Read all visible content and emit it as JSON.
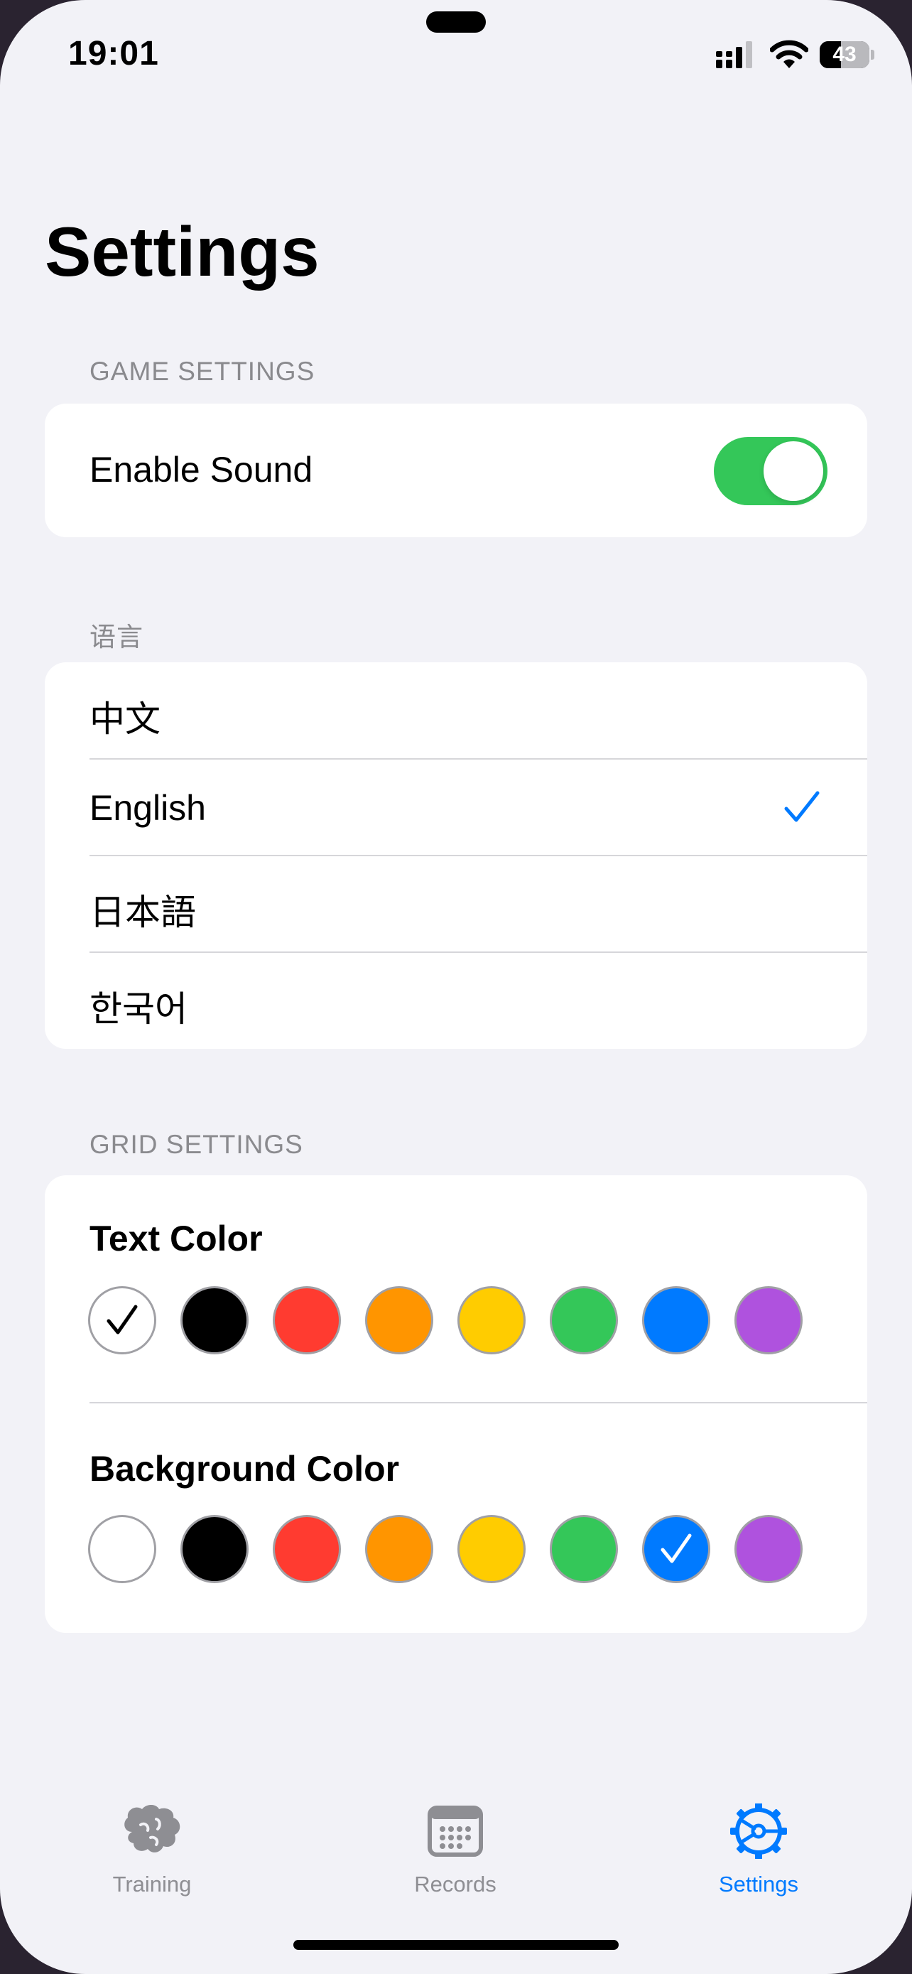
{
  "status_bar": {
    "time": "19:01",
    "battery": "43",
    "battery_level": 0.43,
    "signal_icon": "cellular-signal-icon",
    "wifi_icon": "wifi-icon"
  },
  "page": {
    "title": "Settings"
  },
  "game_settings": {
    "header": "GAME SETTINGS",
    "enable_sound_label": "Enable Sound",
    "enable_sound_on": true,
    "toggle_on_color": "#34c759"
  },
  "language": {
    "header": "语言",
    "options": [
      {
        "label": "中文",
        "selected": false
      },
      {
        "label": "English",
        "selected": true
      },
      {
        "label": "日本語",
        "selected": false
      },
      {
        "label": "한국어",
        "selected": false
      }
    ],
    "check_icon": "checkmark-icon",
    "check_color": "#007aff"
  },
  "grid_settings": {
    "header": "GRID SETTINGS",
    "text_color": {
      "label": "Text Color",
      "swatches": [
        "#ffffff",
        "#000000",
        "#ff3b30",
        "#ff9500",
        "#ffcc00",
        "#34c759",
        "#007aff",
        "#af52de"
      ],
      "selected_index": 0
    },
    "background_color": {
      "label": "Background Color",
      "swatches": [
        "#ffffff",
        "#000000",
        "#ff3b30",
        "#ff9500",
        "#ffcc00",
        "#34c759",
        "#007aff",
        "#af52de"
      ],
      "selected_index": 6
    }
  },
  "tab_bar": {
    "active_color": "#007aff",
    "inactive_color": "#8e8e93",
    "tabs": [
      {
        "label": "Training",
        "icon": "brain-icon",
        "active": false
      },
      {
        "label": "Records",
        "icon": "calendar-icon",
        "active": false
      },
      {
        "label": "Settings",
        "icon": "gear-icon",
        "active": true
      }
    ]
  }
}
